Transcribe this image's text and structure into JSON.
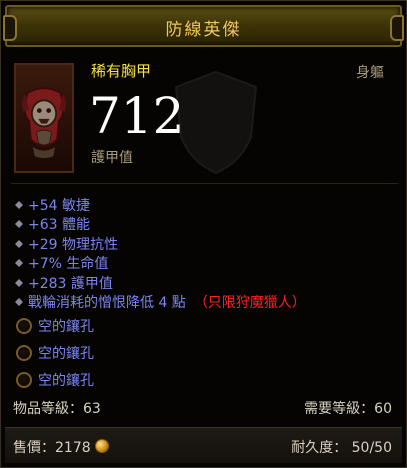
{
  "title": "防線英傑",
  "item": {
    "name": "稀有胸甲",
    "slot": "身軀",
    "armor_value": "712",
    "armor_label": "護甲值",
    "icon": "chest-armor-icon"
  },
  "stats": [
    {
      "text": "+54 敏捷"
    },
    {
      "text": "+63 體能"
    },
    {
      "text": "+29 物理抗性"
    },
    {
      "text": "+7% 生命值"
    },
    {
      "text": "+283 護甲值"
    },
    {
      "text": "戰輪消耗的憎恨降低 4 點",
      "restriction": "（只限狩魔獵人）"
    }
  ],
  "sockets": [
    "空的鑲孔",
    "空的鑲孔",
    "空的鑲孔"
  ],
  "item_level": "物品等級：63",
  "required_level": "需要等級：60",
  "price": "售價：2178",
  "durability": "耐久度： 50/50",
  "colors": {
    "title": "#f2c75c",
    "item_name": "#f5e040",
    "stat_blue": "#7d84ee",
    "restriction_red": "#ff2020",
    "muted": "#a89c7e"
  }
}
